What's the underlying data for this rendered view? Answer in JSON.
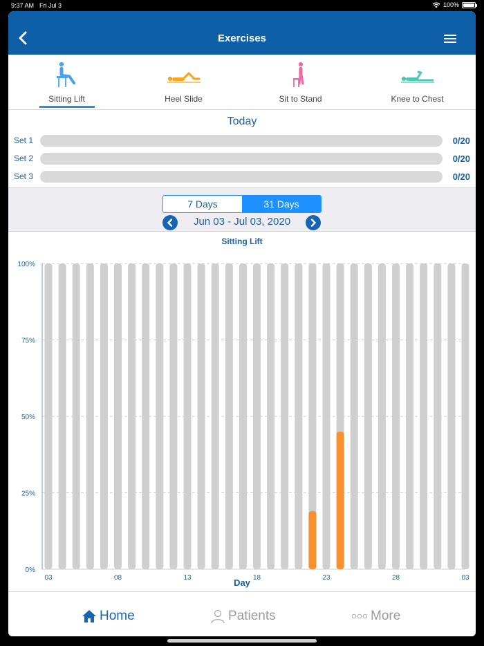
{
  "status": {
    "time": "9:37 AM",
    "date": "Fri Jul 3",
    "battery": "100%"
  },
  "navbar": {
    "title": "Exercises"
  },
  "exercises": [
    {
      "label": "Sitting Lift",
      "icon": "sitting-lift-icon",
      "color": "#4aa3e8",
      "selected": true
    },
    {
      "label": "Heel Slide",
      "icon": "heel-slide-icon",
      "color": "#f6a623",
      "selected": false
    },
    {
      "label": "Sit to Stand",
      "icon": "sit-to-stand-icon",
      "color": "#ec6aa2",
      "selected": false
    },
    {
      "label": "Knee to Chest",
      "icon": "knee-to-chest-icon",
      "color": "#4fc8b4",
      "selected": false
    }
  ],
  "today": {
    "title": "Today",
    "sets": [
      {
        "label": "Set 1",
        "value": "0/20"
      },
      {
        "label": "Set 2",
        "value": "0/20"
      },
      {
        "label": "Set 3",
        "value": "0/20"
      }
    ]
  },
  "range": {
    "seven_days": "7 Days",
    "thirty_one_days": "31 Days",
    "selected": "31 Days",
    "label": "Jun 03 - Jul 03, 2020"
  },
  "chart_data": {
    "type": "bar",
    "title": "Sitting Lift",
    "xlabel": "Day",
    "ylabel": "",
    "ylim": [
      0,
      100
    ],
    "yticks": [
      "0%",
      "25%",
      "50%",
      "75%",
      "100%"
    ],
    "xticks": [
      "03",
      "08",
      "13",
      "18",
      "23",
      "28",
      "03"
    ],
    "categories": [
      "Jun 03",
      "Jun 04",
      "Jun 05",
      "Jun 06",
      "Jun 07",
      "Jun 08",
      "Jun 09",
      "Jun 10",
      "Jun 11",
      "Jun 12",
      "Jun 13",
      "Jun 14",
      "Jun 15",
      "Jun 16",
      "Jun 17",
      "Jun 18",
      "Jun 19",
      "Jun 20",
      "Jun 21",
      "Jun 22",
      "Jun 23",
      "Jun 24",
      "Jun 25",
      "Jun 26",
      "Jun 27",
      "Jun 28",
      "Jun 29",
      "Jun 30",
      "Jul 01",
      "Jul 02",
      "Jul 03"
    ],
    "values": [
      0,
      0,
      0,
      0,
      0,
      0,
      0,
      0,
      0,
      0,
      0,
      0,
      0,
      0,
      0,
      0,
      0,
      0,
      0,
      19,
      0,
      45,
      0,
      0,
      0,
      0,
      0,
      0,
      0,
      0,
      0
    ],
    "background_value": 100,
    "colors": {
      "value": "#f7902e",
      "background": "#cfcfcf",
      "grid": "#bdbdbd",
      "text": "#1f5f9e"
    },
    "grid": true
  },
  "tabs": [
    {
      "label": "Home",
      "icon": "home-icon",
      "active": true
    },
    {
      "label": "Patients",
      "icon": "person-icon",
      "active": false
    },
    {
      "label": "More",
      "icon": "more-dots-icon",
      "active": false
    }
  ]
}
